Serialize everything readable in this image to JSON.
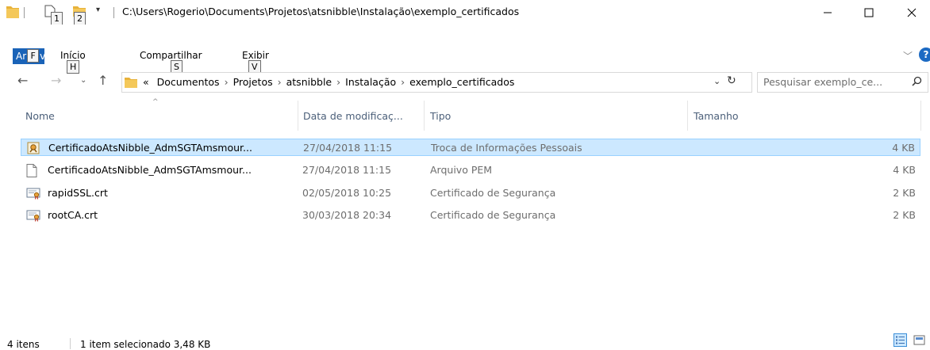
{
  "titlebar": {
    "path": "C:\\Users\\Rogerio\\Documents\\Projetos\\atsnibble\\Instalação\\exemplo_certificados",
    "keytip_1": "1",
    "keytip_2": "2"
  },
  "ribbon": {
    "tabs": [
      {
        "label": "Arquivo",
        "display": "Ar",
        "keytip": "F",
        "tail": "vo"
      },
      {
        "label": "Início",
        "keytip": "H"
      },
      {
        "label": "Compartilhar",
        "keytip": "S"
      },
      {
        "label": "Exibir",
        "keytip": "V"
      }
    ]
  },
  "nav": {
    "breadcrumbs": [
      "Documentos",
      "Projetos",
      "atsnibble",
      "Instalação",
      "exemplo_certificados"
    ],
    "overflow": "«",
    "search_placeholder": "Pesquisar exemplo_ce..."
  },
  "columns": {
    "name": "Nome",
    "date": "Data de modificaç...",
    "type": "Tipo",
    "size": "Tamanho"
  },
  "files": [
    {
      "name": "CertificadoAtsNibble_AdmSGTAmsmour...",
      "date": "27/04/2018 11:15",
      "type": "Troca de Informações Pessoais",
      "size": "4 KB",
      "icon": "pfx-certificate-icon",
      "selected": true
    },
    {
      "name": "CertificadoAtsNibble_AdmSGTAmsmour...",
      "date": "27/04/2018 11:15",
      "type": "Arquivo PEM",
      "size": "4 KB",
      "icon": "blank-file-icon",
      "selected": false
    },
    {
      "name": "rapidSSL.crt",
      "date": "02/05/2018 10:25",
      "type": "Certificado de Segurança",
      "size": "2 KB",
      "icon": "certificate-icon",
      "selected": false
    },
    {
      "name": "rootCA.crt",
      "date": "30/03/2018 20:34",
      "type": "Certificado de Segurança",
      "size": "2 KB",
      "icon": "certificate-icon",
      "selected": false
    }
  ],
  "status": {
    "count": "4 itens",
    "selection": "1 item selecionado  3,48 KB"
  },
  "colors": {
    "accent": "#1a63b8",
    "selection_bg": "#cce8ff",
    "selection_border": "#99d1ff",
    "folder": "#e8b23a"
  }
}
